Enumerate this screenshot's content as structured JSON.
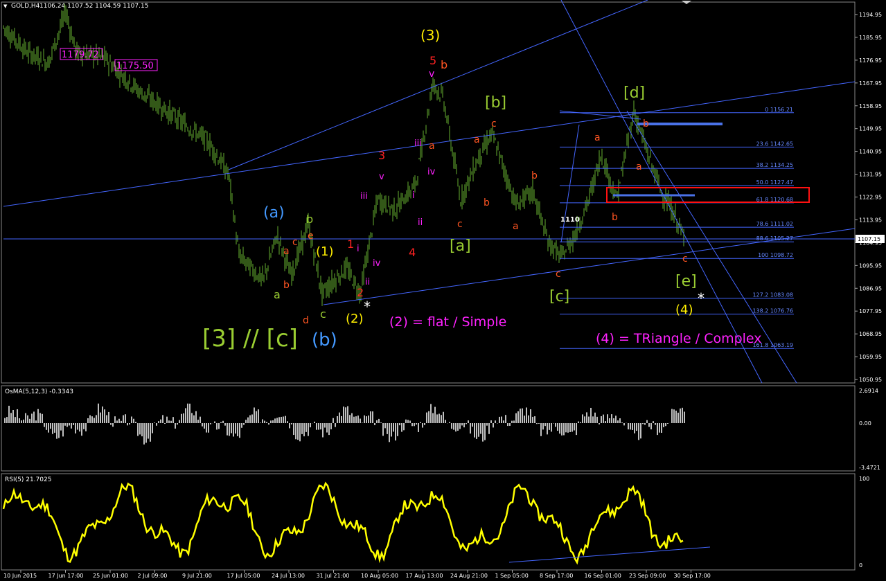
{
  "window": {
    "symbol_label": "GOLD,H4",
    "ohlc_header": "1106.24 1107.52 1104.59 1107.15",
    "current_price": "1107.15"
  },
  "main_axis": {
    "ticks": [
      "1194.95",
      "1185.95",
      "1176.95",
      "1167.95",
      "1158.95",
      "1149.95",
      "1140.95",
      "1131.95",
      "1122.95",
      "1113.95",
      "1104.95",
      "1095.95",
      "1086.95",
      "1077.95",
      "1068.95",
      "1059.95",
      "1050.95"
    ]
  },
  "osma": {
    "header": "OsMA(5,12,3) -0.3343",
    "ticks": [
      "2.6914",
      "0.00",
      "-3.4721"
    ]
  },
  "rsi": {
    "header": "RSI(5) 21.7025",
    "ticks": [
      "100",
      "0"
    ]
  },
  "time_axis": [
    "10 Jun 2015",
    "17 Jun 17:00",
    "25 Jun 01:00",
    "2 Jul 09:00",
    "9 Jul 21:00",
    "17 Jul 05:00",
    "24 Jul 13:00",
    "31 Jul 21:00",
    "10 Aug 05:00",
    "17 Aug 13:00",
    "24 Aug 21:00",
    "1 Sep 05:00",
    "8 Sep 17:00",
    "16 Sep 01:00",
    "23 Sep 09:00",
    "30 Sep 17:00"
  ],
  "price_boxes": [
    "1179.72",
    "1175.50"
  ],
  "fib_levels": [
    {
      "label": "0 1156.21",
      "price": 1156.21
    },
    {
      "label": "23.6 1142.65",
      "price": 1142.65
    },
    {
      "label": "38.2 1134.25",
      "price": 1134.25
    },
    {
      "label": "50.0 1127.47",
      "price": 1127.47
    },
    {
      "label": "61.8 1120.68",
      "price": 1120.68
    },
    {
      "label": "78.6 1111.02",
      "price": 1111.02
    },
    {
      "label": "88.6 1105.27",
      "price": 1105.27
    },
    {
      "label": "100 1098.72",
      "price": 1098.72
    },
    {
      "label": "127.2 1083.08",
      "price": 1083.08
    },
    {
      "label": "138.2 1076.76",
      "price": 1076.76
    },
    {
      "label": "161.8 1063.19",
      "price": 1063.19
    }
  ],
  "annotations": {
    "wave3_yellow": "(3)",
    "wave5_red": "5",
    "b_top": "b",
    "v_top": "v",
    "bracket_b": "[b]",
    "c_top": "c",
    "bracket_d": "[d]",
    "b_d": "b",
    "a1": "a",
    "iii1": "iii",
    "a2": "a",
    "three_red": "3",
    "v_mid": "v",
    "iv_mid": "iv",
    "a3": "a",
    "a_big": "(a)",
    "b_green": "b",
    "e_red": "e",
    "c_red": "c",
    "a_red": "a",
    "one_paren": "(1)",
    "one_red": "1",
    "i_red": "i",
    "iii_mid": "iii",
    "i_mid": "i",
    "b_red2": "b",
    "b_red3": "b",
    "a_red2": "a",
    "ii_mid": "ii",
    "iv_low": "iv",
    "four_red": "4",
    "c_red2": "c",
    "a_red3": "a",
    "bracket_a": "[a]",
    "label_1110": "1110",
    "b_red4": "b",
    "ii_low": "ii",
    "two_red": "2",
    "a_green": "a",
    "b_red5": "b",
    "d_red": "d",
    "c_green": "c",
    "two_paren": "(2)",
    "bracket_c": "[c]",
    "c_red3": "c",
    "c_red4": "c",
    "bracket_e": "[e]",
    "four_paren": "(4)",
    "big_label": "[3] // [c]",
    "b_big": "(b)",
    "flat_note": "(2) = flat / Simple",
    "triangle_note": "(4) = TRiangle / Complex",
    "star": "*"
  },
  "colors": {
    "background": "#000000",
    "candle": "#66b030",
    "trendline": "#4466ff",
    "osma_bars": "#c0c0c0",
    "rsi_line": "#ffff00",
    "red": "#ff2222",
    "orange": "#ff5522",
    "yellow": "#ffee00",
    "olive": "#9acd32",
    "blue": "#4499ff",
    "magenta": "#ff22ff"
  }
}
